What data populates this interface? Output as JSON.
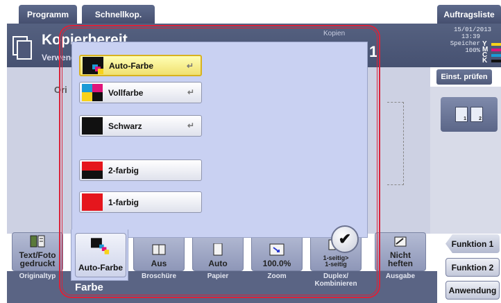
{
  "top_tabs": [
    "Programm",
    "Schnellkop.",
    "Auftragsliste"
  ],
  "header": {
    "title": "Kopierbereit",
    "subtitle": "Verwende",
    "kopien_label": "Kopien",
    "copies_digit": "1",
    "date": "15/01/2013",
    "time": "13:39",
    "speicher_label": "Speicher",
    "speicher_value": "100%",
    "toner": [
      "Y",
      "M",
      "C",
      "K"
    ],
    "toner_colors": [
      "#f7d21a",
      "#e0147a",
      "#1b9ad6",
      "#111111"
    ],
    "einst_button": "Einst. prüfen"
  },
  "background_fragment": "Ori",
  "popup": {
    "options": [
      {
        "label": "Auto-Farbe",
        "icon": "auto-color-swatch",
        "selected": true,
        "return_icon": "↵"
      },
      {
        "label": "Vollfarbe",
        "icon": "full-color-swatch",
        "selected": false,
        "return_icon": "↵"
      },
      {
        "label": "Schwarz",
        "icon": "black-swatch",
        "selected": false,
        "return_icon": "↵"
      },
      {
        "label": "2-farbig",
        "icon": "two-color-swatch",
        "selected": false
      },
      {
        "label": "1-farbig",
        "icon": "single-color-swatch",
        "selected": false
      }
    ],
    "ok_icon": "✔"
  },
  "functions": [
    {
      "value": "Text/Foto\ngedruckt",
      "caption": "Originaltyp",
      "icon": "original-type-icon"
    },
    {
      "value": "Auto-Farbe",
      "caption": "Farbe",
      "icon": "auto-color-icon",
      "active": true
    },
    {
      "value": "Aus",
      "caption": "Broschüre",
      "icon": "booklet-icon"
    },
    {
      "value": "Auto",
      "caption": "Papier",
      "icon": "paper-icon"
    },
    {
      "value": "100.0%",
      "caption": "Zoom",
      "icon": "zoom-icon"
    },
    {
      "value": "1-seitig>\n1-seitig",
      "caption": "Duplex/\nKombinieren",
      "icon": "duplex-icon"
    },
    {
      "value": "Nicht\nheften",
      "caption": "Ausgabe",
      "icon": "output-icon"
    }
  ],
  "right_buttons": [
    "Funktion 1",
    "Funktion 2",
    "Anwendung"
  ],
  "colors": {
    "accent_red": "#d9233a",
    "popup_bg": "#c9d1f2",
    "header_bg": "#4e5878",
    "selected_yellow": "#f0e070"
  }
}
